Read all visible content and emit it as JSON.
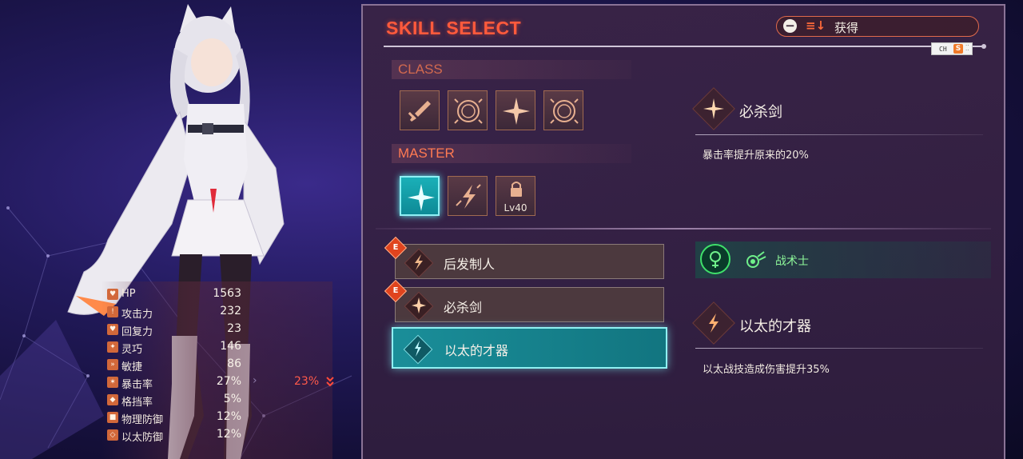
{
  "panel": {
    "title": "SKILL SELECT",
    "sort": {
      "label": "获得",
      "minus_icon": "minus-circle-icon",
      "sort_icon": "sort-arrows-icon"
    },
    "overlay_badge": {
      "text": "CH",
      "s": "S"
    }
  },
  "sections": {
    "class_label": "CLASS",
    "master_label": "MASTER"
  },
  "class_skills": [
    {
      "icon": "sword-icon"
    },
    {
      "icon": "ring-icon"
    },
    {
      "icon": "sparkle-icon"
    },
    {
      "icon": "ring-icon"
    }
  ],
  "master_skills": [
    {
      "icon": "sparkle-icon",
      "selected": true
    },
    {
      "icon": "lightning-icon"
    },
    {
      "icon": "lock-icon",
      "lock_text": "Lv40"
    }
  ],
  "detail_top": {
    "name": "必杀剑",
    "description": "暴击率提升原来的20%"
  },
  "skill_list": [
    {
      "label": "后发制人",
      "badge": "E",
      "icon": "lightning-icon"
    },
    {
      "label": "必杀剑",
      "badge": "E",
      "icon": "sparkle-icon"
    },
    {
      "label": "以太的才器",
      "badge": "",
      "icon": "ether-bolt-icon",
      "active": true
    }
  ],
  "class_info": {
    "name": "战术士",
    "icon": "tactician-icon"
  },
  "detail_bottom": {
    "name": "以太的才器",
    "description": "以太战技造成伤害提升35%"
  },
  "stats": [
    {
      "label": "HP",
      "value": "1563"
    },
    {
      "label": "攻击力",
      "value": "232"
    },
    {
      "label": "回复力",
      "value": "23"
    },
    {
      "label": "灵巧",
      "value": "146"
    },
    {
      "label": "敏捷",
      "value": "86"
    },
    {
      "label": "暴击率",
      "value": "27%",
      "bonus": "23%"
    },
    {
      "label": "格挡率",
      "value": "5%"
    },
    {
      "label": "物理防御",
      "value": "12%"
    },
    {
      "label": "以太防御",
      "value": "12%"
    }
  ],
  "colors": {
    "accent_red": "#ff5a3c",
    "selected_cyan": "#1ab0b8",
    "class_green": "#3fe06a"
  }
}
